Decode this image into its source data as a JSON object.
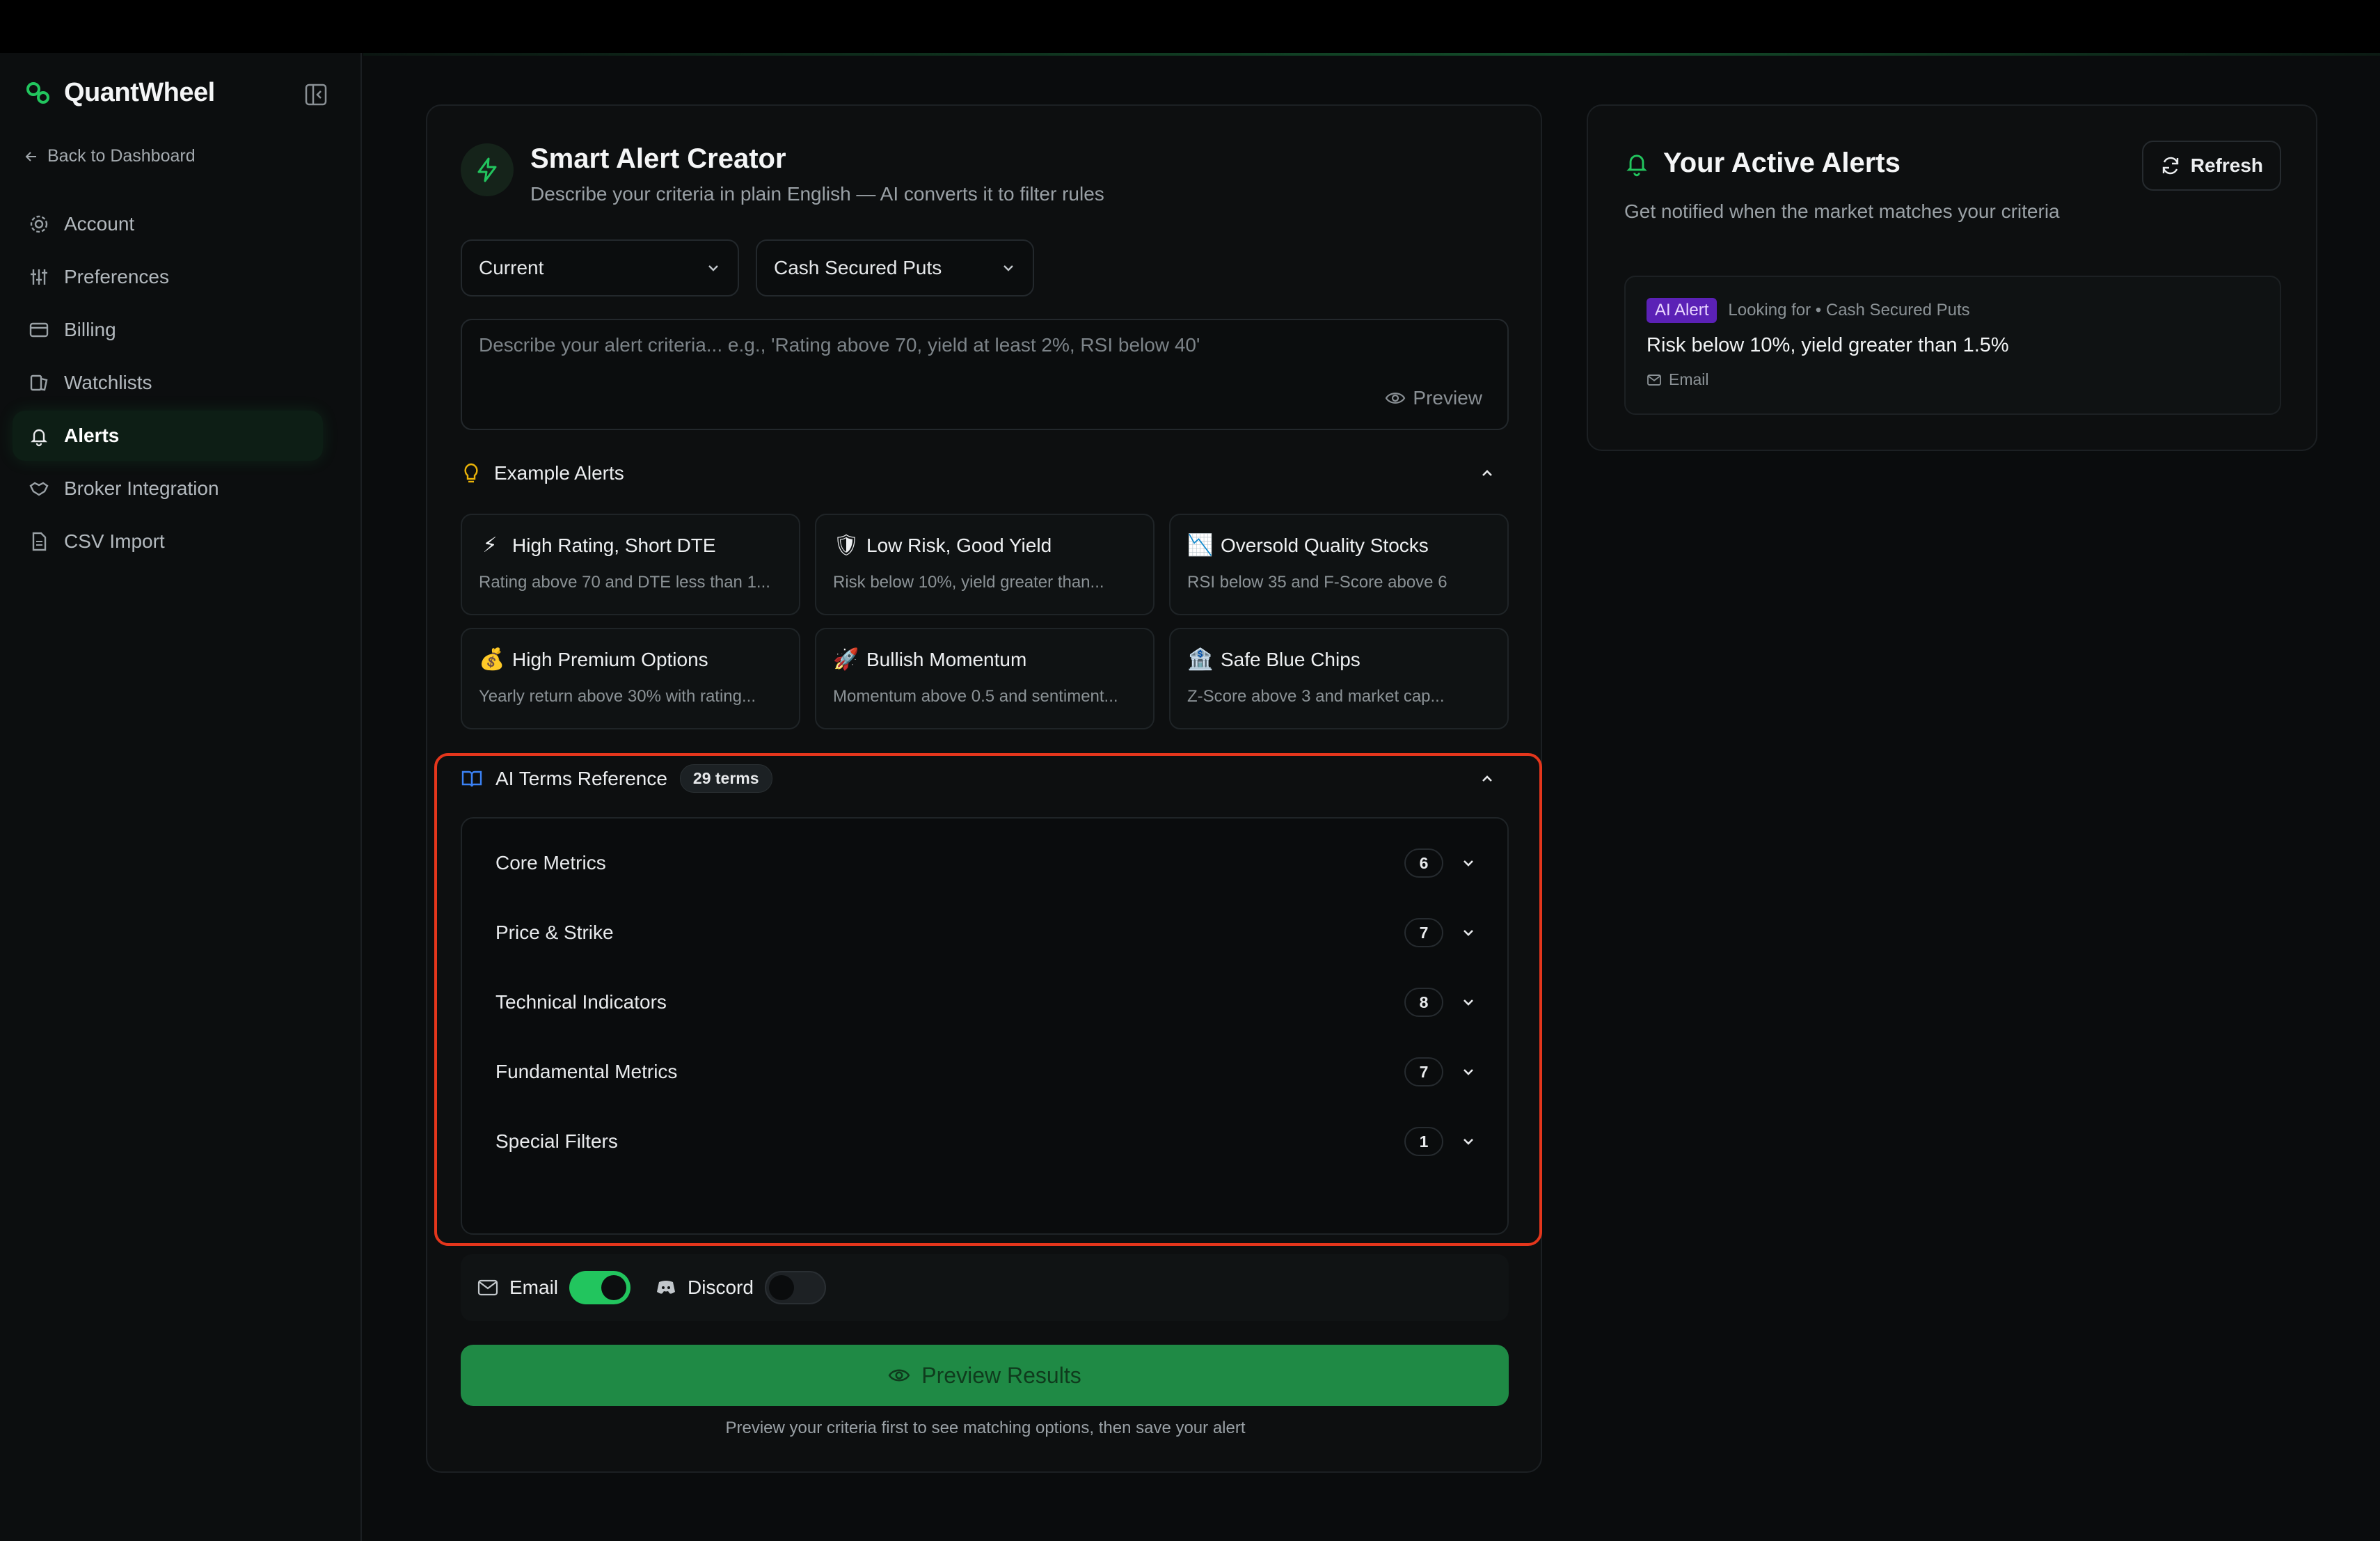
{
  "app": {
    "brand": "QuantWheel"
  },
  "sidebar": {
    "back_label": "Back to Dashboard",
    "items": [
      {
        "label": "Account",
        "icon": "gear-icon"
      },
      {
        "label": "Preferences",
        "icon": "sliders-icon"
      },
      {
        "label": "Billing",
        "icon": "credit-card-icon"
      },
      {
        "label": "Watchlists",
        "icon": "watchlist-icon"
      },
      {
        "label": "Alerts",
        "icon": "bell-icon",
        "active": true
      },
      {
        "label": "Broker Integration",
        "icon": "handshake-icon"
      },
      {
        "label": "CSV Import",
        "icon": "file-icon"
      }
    ]
  },
  "creator": {
    "title": "Smart Alert Creator",
    "subtitle": "Describe your criteria in plain English — AI converts it to filter rules",
    "select_timeframe": "Current",
    "select_strategy": "Cash Secured Puts",
    "textarea_placeholder": "Describe your alert criteria... e.g., 'Rating above 70, yield at least 2%, RSI below 40'",
    "preview_link": "Preview",
    "examples_title": "Example Alerts",
    "examples": [
      {
        "emoji": "⚡",
        "title": "High Rating, Short DTE",
        "desc": "Rating above 70 and DTE less than 1..."
      },
      {
        "emoji": "🛡",
        "title": "Low Risk, Good Yield",
        "desc": "Risk below 10%, yield greater than..."
      },
      {
        "emoji": "📉",
        "title": "Oversold Quality Stocks",
        "desc": "RSI below 35 and F-Score above 6"
      },
      {
        "emoji": "💰",
        "title": "High Premium Options",
        "desc": "Yearly return above 30% with rating..."
      },
      {
        "emoji": "🚀",
        "title": "Bullish Momentum",
        "desc": "Momentum above 0.5 and sentiment..."
      },
      {
        "emoji": "🏦",
        "title": "Safe Blue Chips",
        "desc": "Z-Score above 3 and market cap..."
      }
    ],
    "terms_title": "AI Terms Reference",
    "terms_badge": "29 terms",
    "terms": [
      {
        "label": "Core Metrics",
        "count": "6"
      },
      {
        "label": "Price & Strike",
        "count": "7"
      },
      {
        "label": "Technical Indicators",
        "count": "8"
      },
      {
        "label": "Fundamental Metrics",
        "count": "7"
      },
      {
        "label": "Special Filters",
        "count": "1"
      }
    ],
    "email_label": "Email",
    "discord_label": "Discord",
    "email_enabled": true,
    "discord_enabled": false,
    "preview_button": "Preview Results",
    "preview_hint": "Preview your criteria first to see matching options, then save your alert"
  },
  "active_alerts": {
    "title": "Your Active Alerts",
    "refresh_label": "Refresh",
    "subtitle": "Get notified when the market matches your criteria",
    "alerts": [
      {
        "badge": "AI Alert",
        "looking_for": "Looking for • Cash Secured Puts",
        "text": "Risk below 10%, yield greater than 1.5%",
        "channel": "Email"
      }
    ]
  },
  "colors": {
    "accent": "#22c55e",
    "highlight": "#e4361c",
    "badge": "#5b21b6"
  }
}
